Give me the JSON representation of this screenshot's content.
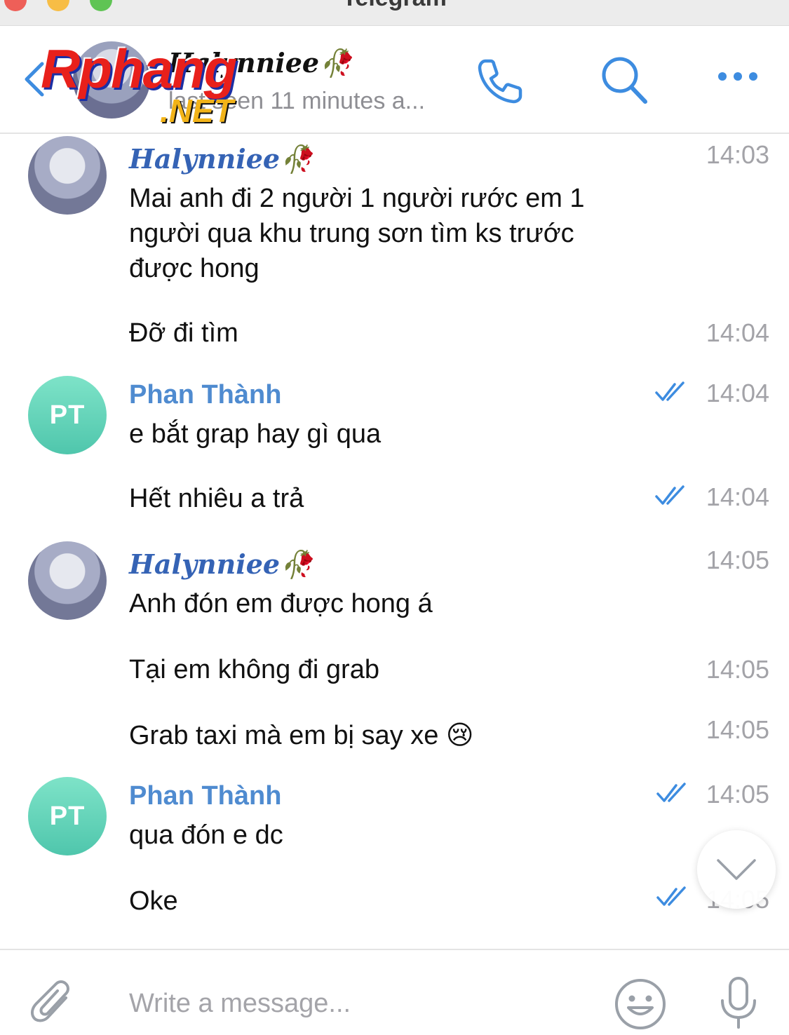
{
  "window": {
    "title": "Telegram"
  },
  "header": {
    "contact_name": "Halynniee🥀",
    "status": "last seen 11 minutes a...",
    "watermark_main": "Rphang",
    "watermark_sub": ".NET",
    "icons": {
      "back": "chevron-left-icon",
      "call": "phone-icon",
      "search": "search-icon",
      "more": "more-dots-icon"
    }
  },
  "messages": [
    {
      "sender": "Halynniee🥀",
      "time": "14:03",
      "lines": [
        "Mai anh đi 2 người 1 người rước em 1",
        "người qua khu trung sơn tìm ks trước",
        "được hong"
      ]
    },
    {
      "sender": "",
      "time": "14:04",
      "lines": [
        "Đỡ đi tìm"
      ]
    },
    {
      "sender": "Phan Thành",
      "initials": "PT",
      "time": "14:04",
      "read": true,
      "lines": [
        "e bắt grap hay gì qua"
      ]
    },
    {
      "sender": "",
      "time": "14:04",
      "read": true,
      "lines": [
        "Hết nhiêu a trả"
      ]
    },
    {
      "sender": "Halynniee🥀",
      "time": "14:05",
      "lines": [
        "Anh đón em được hong á"
      ]
    },
    {
      "sender": "",
      "time": "14:05",
      "lines": [
        "Tại em không đi grab"
      ]
    },
    {
      "sender": "",
      "time": "14:05",
      "lines": [
        "Grab taxi mà em bị say xe 😢"
      ]
    },
    {
      "sender": "Phan Thành",
      "initials": "PT",
      "time": "14:05",
      "read": true,
      "lines": [
        "qua đón e dc"
      ]
    },
    {
      "sender": "",
      "time": "14:05",
      "read": true,
      "lines": [
        "Oke"
      ]
    }
  ],
  "composer": {
    "placeholder": "Write a message...",
    "icons": {
      "attach": "paperclip-icon",
      "emoji": "smiley-icon",
      "voice": "microphone-icon"
    }
  },
  "colors": {
    "accent": "#3d8ce0",
    "sender_fancy": "#3563b5",
    "sender_plain": "#4f8bd0",
    "avatar_pt": "#5fd1b6",
    "time": "#a3a3a8"
  }
}
